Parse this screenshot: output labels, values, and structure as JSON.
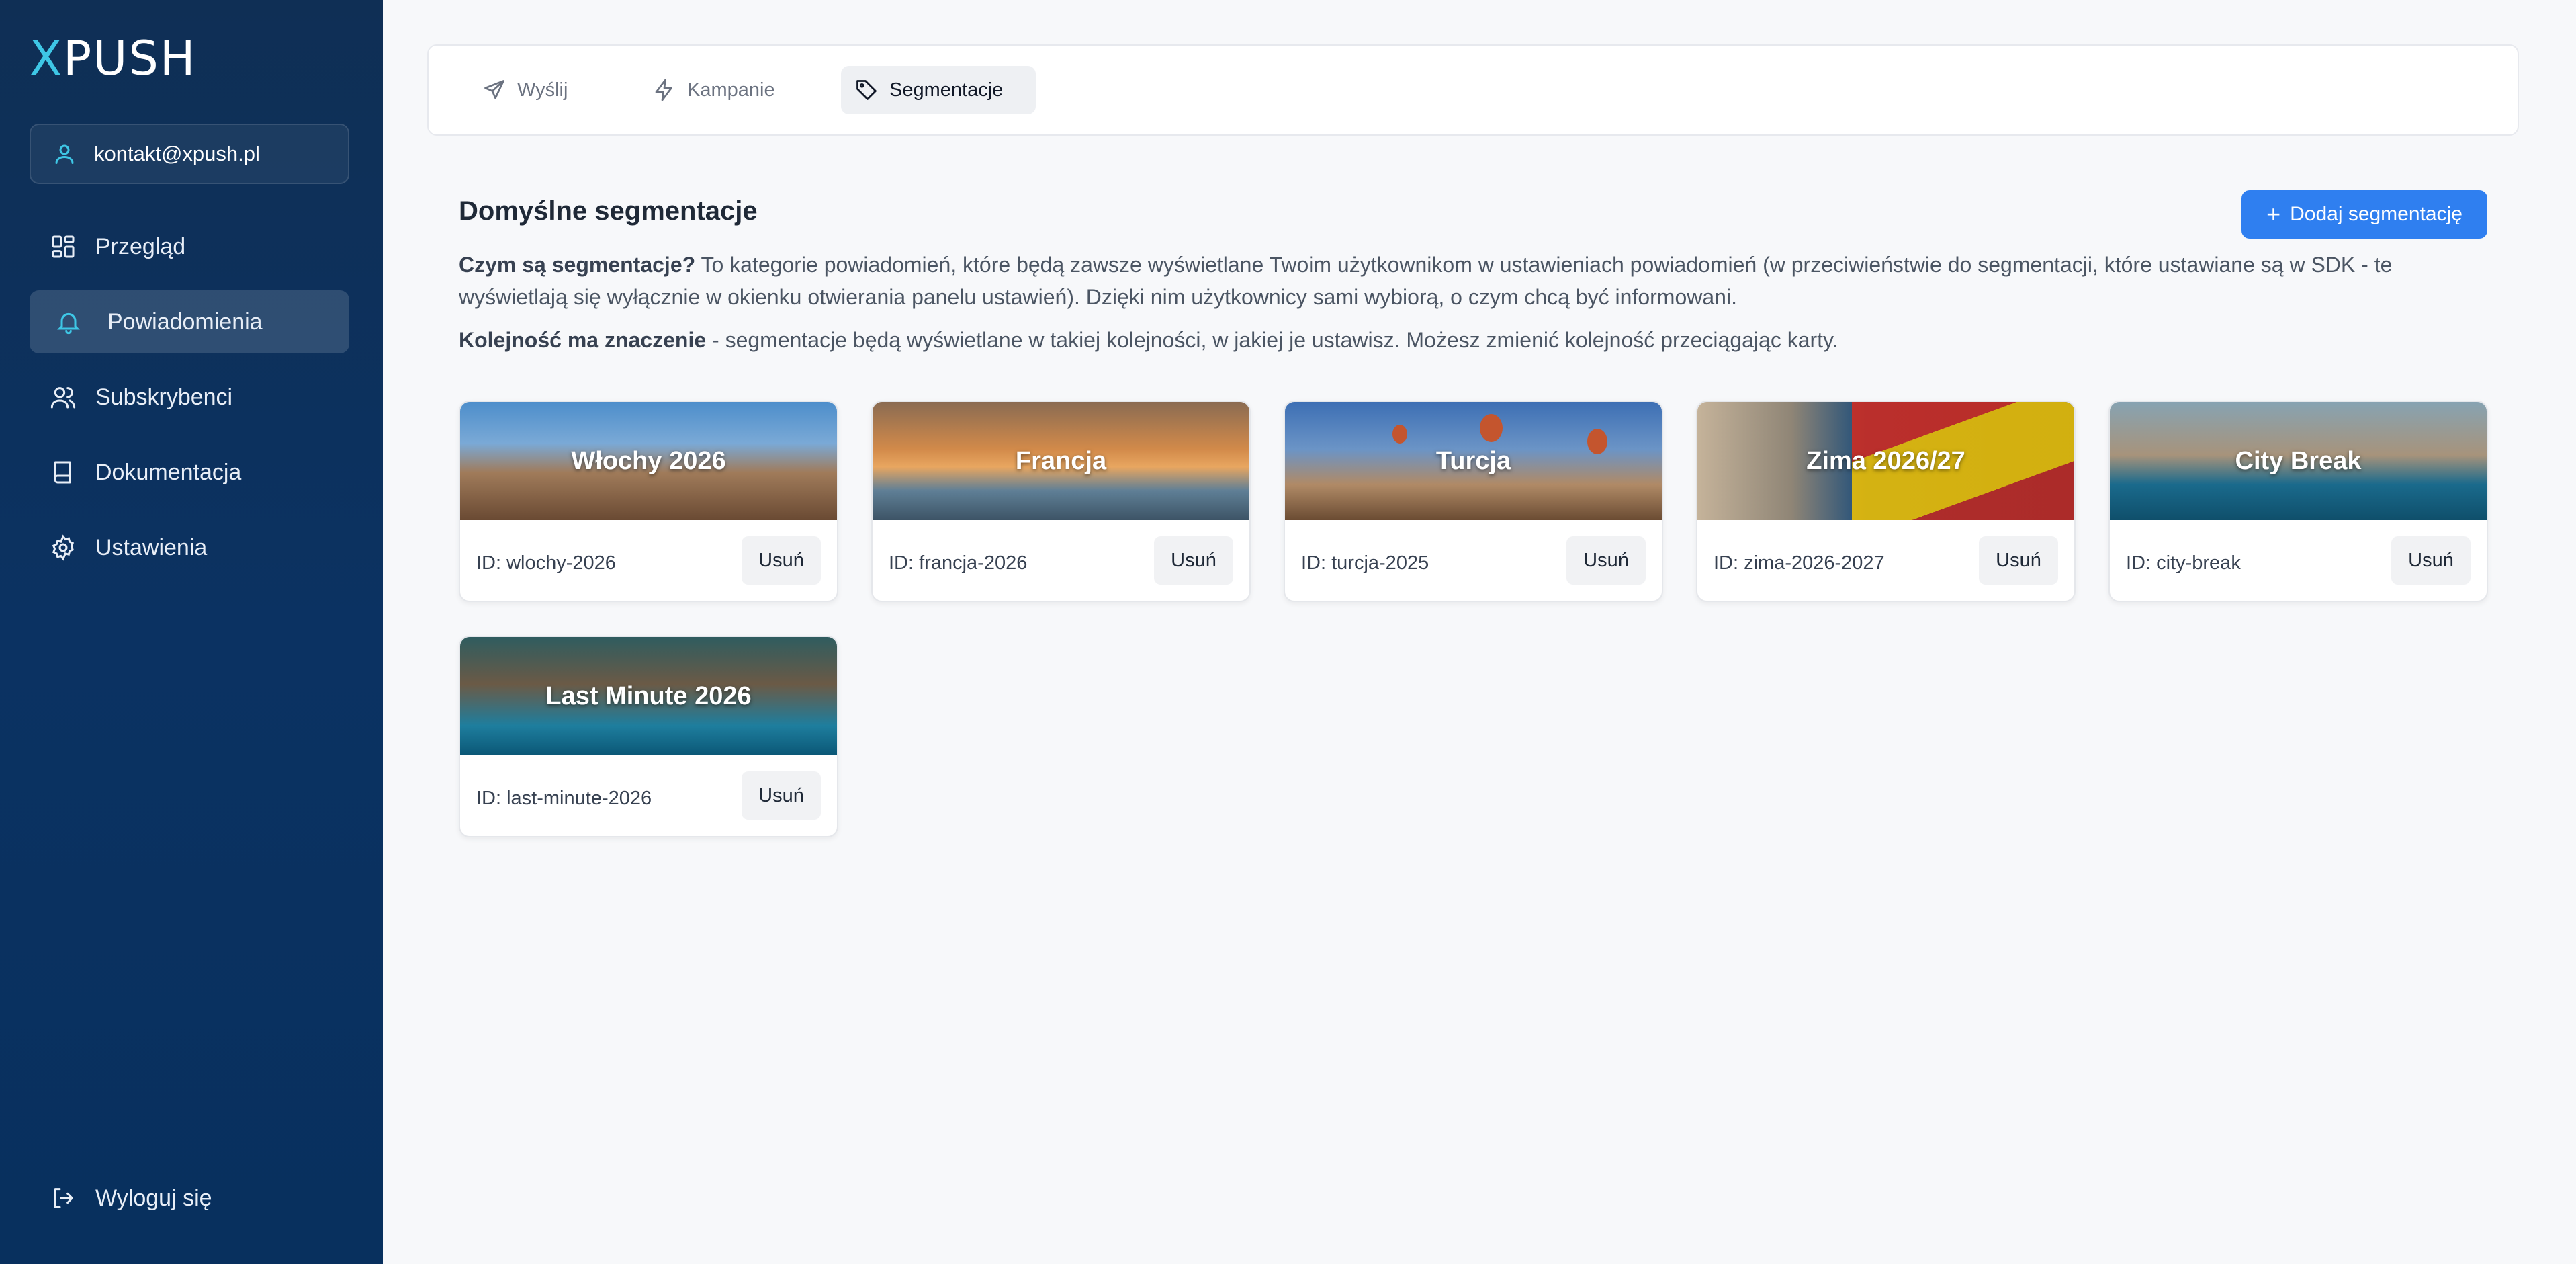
{
  "app": {
    "logo_x": "X",
    "logo_rest": "PUSH"
  },
  "account": {
    "email": "kontakt@xpush.pl"
  },
  "nav": [
    {
      "label": "Przegląd"
    },
    {
      "label": "Powiadomienia"
    },
    {
      "label": "Subskrybenci"
    },
    {
      "label": "Dokumentacja"
    },
    {
      "label": "Ustawienia"
    }
  ],
  "logout": {
    "label": "Wyloguj się"
  },
  "tabs": [
    {
      "label": "Wyślij"
    },
    {
      "label": "Kampanie"
    },
    {
      "label": "Segmentacje"
    }
  ],
  "main": {
    "heading": "Domyślne segmentacje",
    "add_button": "Dodaj segmentację",
    "desc_bold": "Czym są segmentacje?",
    "desc_text": " To kategorie powiadomień, które będą zawsze wyświetlane Twoim użytkownikom w ustawieniach powiadomień (w przeciwieństwie do segmentacji, które ustawiane są w SDK - te wyświetlają się wyłącznie w okienku otwierania panelu ustawień). Dzięki nim użytkownicy sami wybiorą, o czym chcą być informowani.",
    "desc2_bold": "Kolejność ma znaczenie",
    "desc2_text": " - segmentacje będą wyświetlane w takiej kolejności, w jakiej je ustawisz. Możesz zmienić kolejność przeciągając karty."
  },
  "cards": [
    {
      "title": "Włochy 2026",
      "id": "ID: wlochy-2026",
      "delete": "Usuń"
    },
    {
      "title": "Francja",
      "id": "ID: francja-2026",
      "delete": "Usuń"
    },
    {
      "title": "Turcja",
      "id": "ID: turcja-2025",
      "delete": "Usuń"
    },
    {
      "title": "Zima 2026/27",
      "id": "ID: zima-2026-2027",
      "delete": "Usuń"
    },
    {
      "title": "City Break",
      "id": "ID: city-break",
      "delete": "Usuń"
    },
    {
      "title": "Last Minute 2026",
      "id": "ID: last-minute-2026",
      "delete": "Usuń"
    }
  ],
  "colors": {
    "accent": "#2f7ff0",
    "sidebar": "#0b3262",
    "logo_accent": "#3ec7e6"
  }
}
